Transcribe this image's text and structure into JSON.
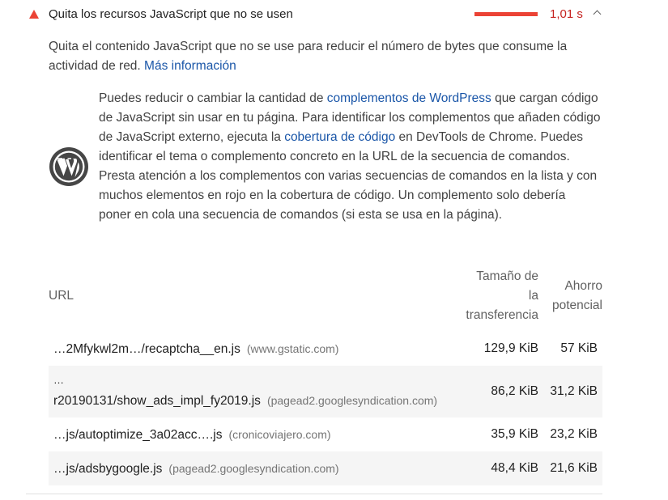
{
  "audit": {
    "title": "Quita los recursos JavaScript que no se usen",
    "savings_display": "1,01 s",
    "savings_fraction": 1.0,
    "fail_color": "#eb4335",
    "icon": "fail-triangle-icon",
    "expand_icon": "chevron-up-icon"
  },
  "description": {
    "text": "Quita el contenido JavaScript que no se use para reducir el número de bytes que consume la actividad de red. ",
    "link_label": "Más información"
  },
  "stack_pack": {
    "icon": "wordpress-icon",
    "text_1": "Puedes reducir o cambiar la cantidad de ",
    "link_1": "complementos de WordPress",
    "text_2": " que cargan código de JavaScript sin usar en tu página. Para identificar los complementos que añaden código de JavaScript externo, ejecuta la ",
    "link_2": "cobertura de código",
    "text_3": " en DevTools de Chrome. Puedes identificar el tema o complemento concreto en la URL de la secuencia de comandos. Presta atención a los complementos con varias secuencias de comandos en la lista y con muchos elementos en rojo en la cobertura de código. Un complemento solo debería poner en cola una secuencia de comandos (si esta se usa en la página)."
  },
  "table": {
    "headers": {
      "url": "URL",
      "transfer_l1": "Tamaño de",
      "transfer_l2": "la",
      "transfer_l3": "transferencia",
      "savings_l1": "Ahorro",
      "savings_l2": "potencial"
    },
    "rows": [
      {
        "prefix": "",
        "url": "…2Mfykwl2m…/recaptcha__en.js",
        "host": "(www.gstatic.com)",
        "size": "129,9 KiB",
        "saving": "57 KiB"
      },
      {
        "prefix": "…",
        "url": "r20190131/show_ads_impl_fy2019.js",
        "host": "(pagead2.googlesyndication.com)",
        "size": "86,2 KiB",
        "saving": "31,2 KiB"
      },
      {
        "prefix": "",
        "url": "…js/autoptimize_3a02acc….js",
        "host": "(cronicoviajero.com)",
        "size": "35,9 KiB",
        "saving": "23,2 KiB"
      },
      {
        "prefix": "",
        "url": "…js/adsbygoogle.js",
        "host": "(pagead2.googlesyndication.com)",
        "size": "48,4 KiB",
        "saving": "21,6 KiB"
      }
    ]
  }
}
